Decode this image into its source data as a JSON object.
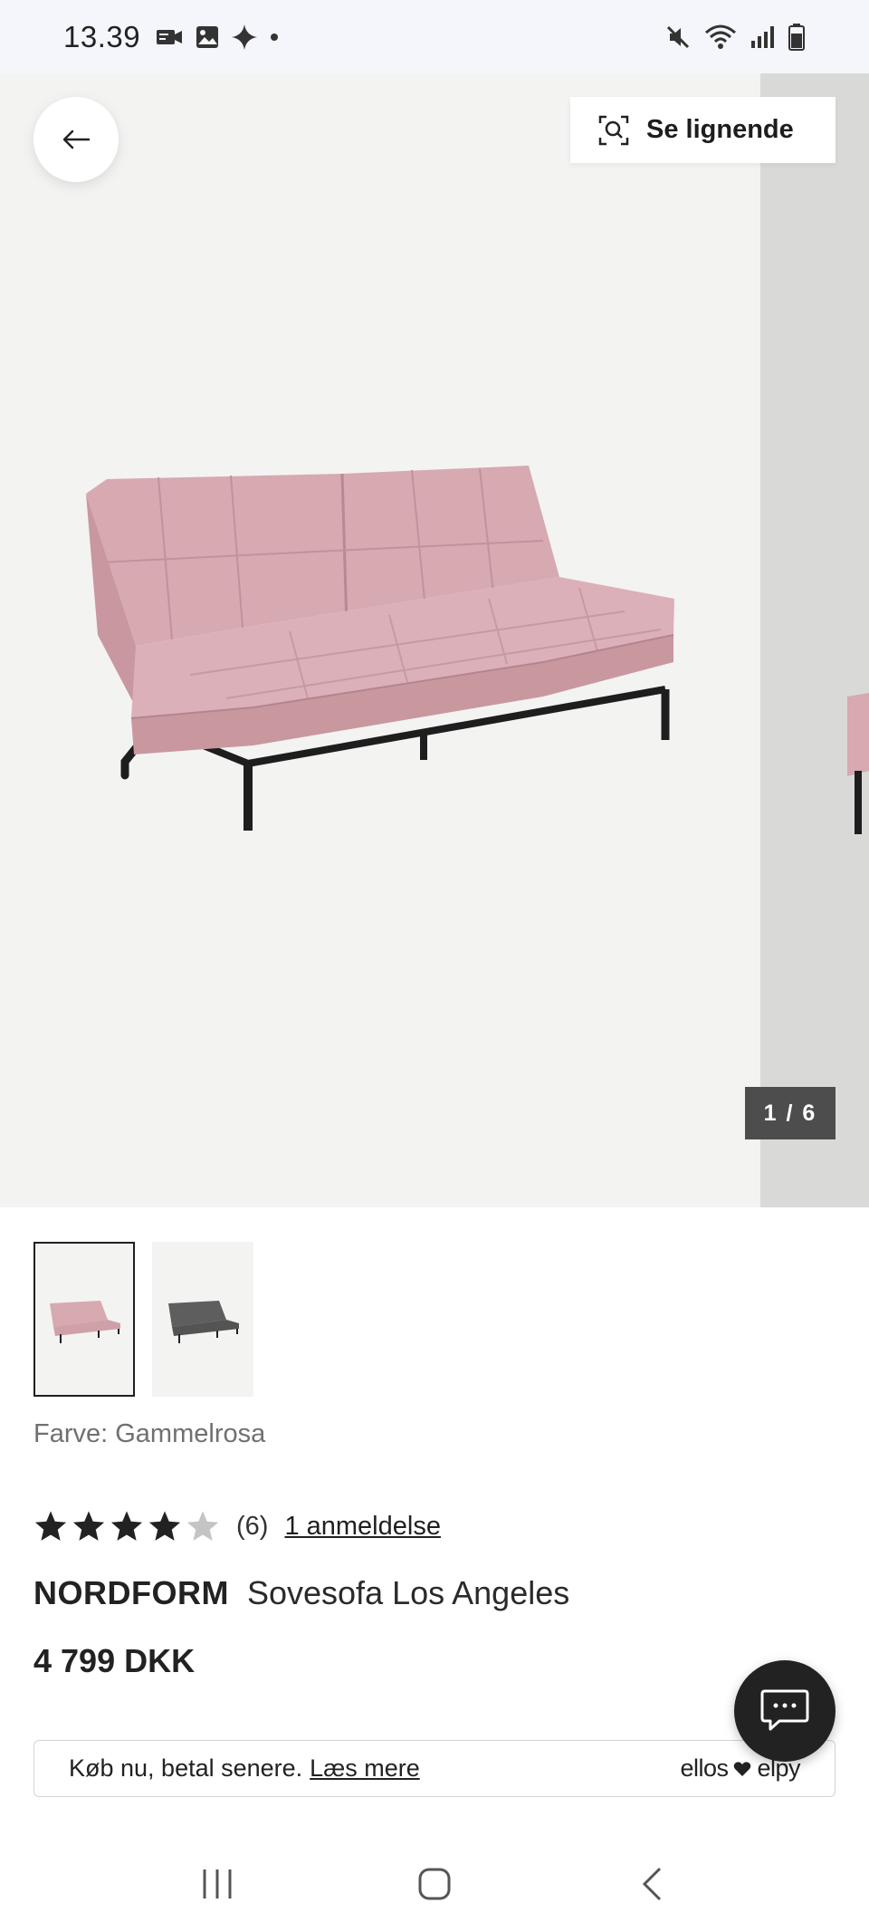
{
  "status_bar": {
    "time": "13.39",
    "left_icons": [
      "video-call-icon",
      "gallery-icon",
      "sparkle-icon",
      "dot-icon"
    ],
    "right_icons": [
      "mute-icon",
      "wifi-icon",
      "signal-icon",
      "battery-icon"
    ]
  },
  "gallery": {
    "similar_label": "Se lignende",
    "counter": "1 / 6"
  },
  "thumbnails": [
    {
      "color": "Gammelrosa",
      "selected": true
    },
    {
      "color": "dark-grey",
      "selected": false
    }
  ],
  "product": {
    "color_label": "Farve: Gammelrosa",
    "rating": 4,
    "rating_max": 5,
    "rating_count": "(6)",
    "reviews_link": "1 anmeldelse",
    "brand": "NORDFORM",
    "name": "Sovesofa Los Angeles",
    "price": "4 799 DKK"
  },
  "paylater": {
    "text": "Køb nu, betal senere.",
    "link": "Læs mere",
    "logo_left": "ellos",
    "logo_right": "elpy"
  },
  "colors": {
    "sofa_pink": "#d4a5ae",
    "sofa_grey": "#5a5a5a",
    "gallery_bg": "#f3f3f2",
    "accent_dark": "#222222"
  },
  "nav": [
    "recent-apps-icon",
    "home-icon",
    "back-nav-icon"
  ]
}
